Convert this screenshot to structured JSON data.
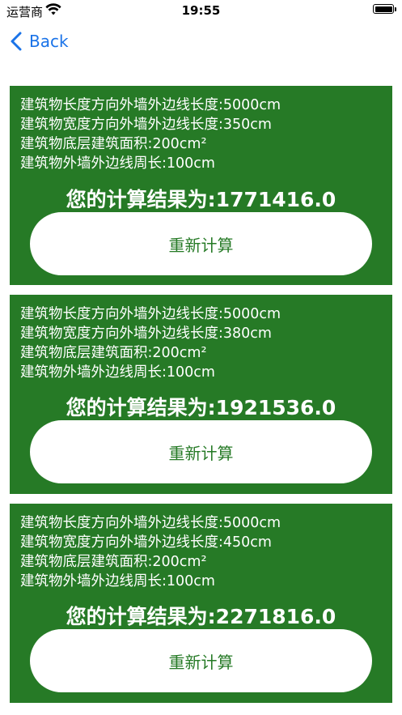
{
  "status_bar": {
    "carrier": "运营商",
    "time": "19:55"
  },
  "nav": {
    "back_label": "Back"
  },
  "cards": [
    {
      "lines": [
        "建筑物长度方向外墙外边线长度:5000cm",
        "建筑物宽度方向外墙外边线长度:350cm",
        "建筑物底层建筑面积:200cm²",
        "建筑物外墙外边线周长:100cm"
      ],
      "result": "您的计算结果为:1771416.0",
      "button_label": "重新计算"
    },
    {
      "lines": [
        "建筑物长度方向外墙外边线长度:5000cm",
        "建筑物宽度方向外墙外边线长度:380cm",
        "建筑物底层建筑面积:200cm²",
        "建筑物外墙外边线周长:100cm"
      ],
      "result": "您的计算结果为:1921536.0",
      "button_label": "重新计算"
    },
    {
      "lines": [
        "建筑物长度方向外墙外边线长度:5000cm",
        "建筑物宽度方向外墙外边线长度:450cm",
        "建筑物底层建筑面积:200cm²",
        "建筑物外墙外边线周长:100cm"
      ],
      "result": "您的计算结果为:2271816.0",
      "button_label": "重新计算"
    }
  ],
  "colors": {
    "card_background": "#267a26",
    "accent": "#1a73e8",
    "text_on_card": "#ffffff",
    "button_background": "#ffffff"
  }
}
